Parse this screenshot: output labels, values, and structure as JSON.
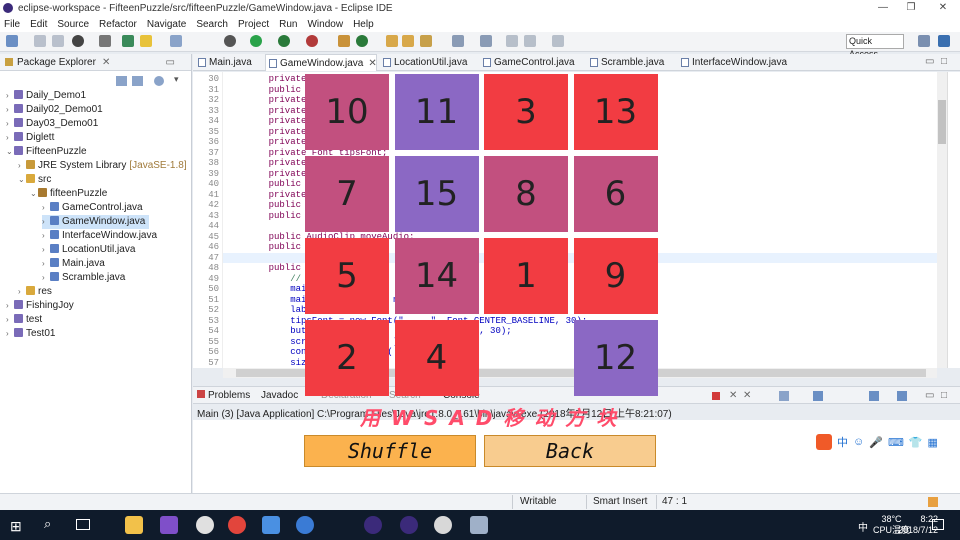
{
  "window": {
    "title": "eclipse-workspace - FifteenPuzzle/src/fifteenPuzzle/GameWindow.java - Eclipse IDE",
    "min": "—",
    "max": "❐",
    "close": "✕"
  },
  "menu": [
    "File",
    "Edit",
    "Source",
    "Refactor",
    "Navigate",
    "Search",
    "Project",
    "Run",
    "Window",
    "Help"
  ],
  "quick_access": "Quick Access",
  "package_explorer": {
    "title": "Package Explorer",
    "items": [
      {
        "label": "Daily_Demo1",
        "indent": 0,
        "toggle": "›",
        "icon": "project"
      },
      {
        "label": "Daily02_Demo01",
        "indent": 0,
        "toggle": "›",
        "icon": "project"
      },
      {
        "label": "Day03_Demo01",
        "indent": 0,
        "toggle": "›",
        "icon": "project"
      },
      {
        "label": "Diglett",
        "indent": 0,
        "toggle": "›",
        "icon": "project"
      },
      {
        "label": "FifteenPuzzle",
        "indent": 0,
        "toggle": "⌄",
        "icon": "project"
      },
      {
        "label": "JRE System Library",
        "extra": "[JavaSE-1.8]",
        "indent": 1,
        "toggle": "›",
        "icon": "library"
      },
      {
        "label": "src",
        "indent": 1,
        "toggle": "⌄",
        "icon": "folder"
      },
      {
        "label": "fifteenPuzzle",
        "indent": 2,
        "toggle": "⌄",
        "icon": "package"
      },
      {
        "label": "GameControl.java",
        "indent": 3,
        "toggle": "›",
        "icon": "java"
      },
      {
        "label": "GameWindow.java",
        "indent": 3,
        "toggle": "›",
        "icon": "java",
        "selected": true
      },
      {
        "label": "InterfaceWindow.java",
        "indent": 3,
        "toggle": "›",
        "icon": "java"
      },
      {
        "label": "LocationUtil.java",
        "indent": 3,
        "toggle": "›",
        "icon": "java"
      },
      {
        "label": "Main.java",
        "indent": 3,
        "toggle": "›",
        "icon": "java"
      },
      {
        "label": "Scramble.java",
        "indent": 3,
        "toggle": "›",
        "icon": "java"
      },
      {
        "label": "res",
        "indent": 1,
        "toggle": "›",
        "icon": "folder"
      },
      {
        "label": "FishingJoy",
        "indent": 0,
        "toggle": "›",
        "icon": "project"
      },
      {
        "label": "test",
        "indent": 0,
        "toggle": "›",
        "icon": "project"
      },
      {
        "label": "Test01",
        "indent": 0,
        "toggle": "›",
        "icon": "project"
      }
    ]
  },
  "editor_tabs": [
    {
      "label": "Main.java",
      "active": false
    },
    {
      "label": "GameWindow.java",
      "active": true,
      "close": "✕"
    },
    {
      "label": "LocationUtil.java",
      "active": false
    },
    {
      "label": "GameControl.java",
      "active": false
    },
    {
      "label": "Scramble.java",
      "active": false
    },
    {
      "label": "InterfaceWindow.java",
      "active": false
    }
  ],
  "code_lines": [
    {
      "n": "30",
      "t": "    private JPan"
    },
    {
      "n": "31",
      "t": "    public JLabe"
    },
    {
      "n": "32",
      "t": "    private JPan"
    },
    {
      "n": "33",
      "t": "    private JBut                   n;"
    },
    {
      "n": "34",
      "t": "    private JBut"
    },
    {
      "n": "35",
      "t": "    private JPan"
    },
    {
      "n": "36",
      "t": "    private Font"
    },
    {
      "n": "37",
      "t": "    private Font tipsFont;"
    },
    {
      "n": "38",
      "t": "    private Font"
    },
    {
      "n": "39",
      "t": "    private bool"
    },
    {
      "n": "40",
      "t": "    public Scram"
    },
    {
      "n": "41",
      "t": "    private Game"
    },
    {
      "n": "42",
      "t": "    public boole                   ue"
    },
    {
      "n": "43",
      "t": "    public int s"
    },
    {
      "n": "44",
      "t": ""
    },
    {
      "n": "45",
      "t": "    public AudioClip moveAudio;"
    },
    {
      "n": "46",
      "t": "    public Audio"
    },
    {
      "n": "47",
      "t": ""
    },
    {
      "n": "48",
      "t": "    public GameW"
    },
    {
      "n": "49",
      "t": "        // TODO                  on"
    },
    {
      "n": "50",
      "t": "        mainPane                  ;"
    },
    {
      "n": "51",
      "t": "        mainPane           ne            0"
    },
    {
      "n": "52",
      "t": "        labelFo                          ;"
    },
    {
      "n": "53",
      "t": "        tipsFont = new Font(\"     \", Font.CENTER_BASELINE, 30);"
    },
    {
      "n": "54",
      "t": "        buttonFo                    ASELINE, 30);"
    },
    {
      "n": "55",
      "t": "        scramble           )"
    },
    {
      "n": "56",
      "t": "        control          l("
    },
    {
      "n": "57",
      "t": "        size = n"
    }
  ],
  "console": {
    "tabs": [
      "Problems",
      "Javadoc",
      "Declaration",
      "Search",
      "Console"
    ],
    "path": "Main (3) [Java Application] C:\\Program Files\\Java\\jre1.8.0_161\\bin\\javaw.exe (2018年7月12日 上午8:21:07)"
  },
  "puzzle": {
    "tiles": [
      {
        "label": "10",
        "row": 0,
        "col": 0,
        "color": "#c2507f"
      },
      {
        "label": "11",
        "row": 0,
        "col": 1,
        "color": "#8b68c4"
      },
      {
        "label": "3",
        "row": 0,
        "col": 2,
        "color": "#f23c42"
      },
      {
        "label": "13",
        "row": 0,
        "col": 3,
        "color": "#f23c42"
      },
      {
        "label": "7",
        "row": 1,
        "col": 0,
        "color": "#c2507f"
      },
      {
        "label": "15",
        "row": 1,
        "col": 1,
        "color": "#8b68c4"
      },
      {
        "label": "8",
        "row": 1,
        "col": 2,
        "color": "#c2507f"
      },
      {
        "label": "6",
        "row": 1,
        "col": 3,
        "color": "#c2507f"
      },
      {
        "label": "5",
        "row": 2,
        "col": 0,
        "color": "#f23c42"
      },
      {
        "label": "14",
        "row": 2,
        "col": 1,
        "color": "#c2507f"
      },
      {
        "label": "1",
        "row": 2,
        "col": 2,
        "color": "#f23c42"
      },
      {
        "label": "9",
        "row": 2,
        "col": 3,
        "color": "#f23c42"
      },
      {
        "label": "2",
        "row": 3,
        "col": 0,
        "color": "#f23c42"
      },
      {
        "label": "4",
        "row": 3,
        "col": 1,
        "color": "#f23c42"
      },
      {
        "label": "12",
        "row": 3,
        "col": 3,
        "color": "#8b68c4"
      }
    ],
    "hint": "用 W S A D 移 动 方 块",
    "shuffle_label": "Shuffle",
    "back_label": "Back",
    "shuffle_color": "#fbb24e",
    "back_color": "#f8cc8f"
  },
  "status": {
    "writable": "Writable",
    "insert": "Smart Insert",
    "position": "47 : 1"
  },
  "taskbar": {
    "temp": "38°C",
    "cpu": "CPU温度",
    "time": "8:22",
    "date": "2018/7/12",
    "ime": "中"
  }
}
